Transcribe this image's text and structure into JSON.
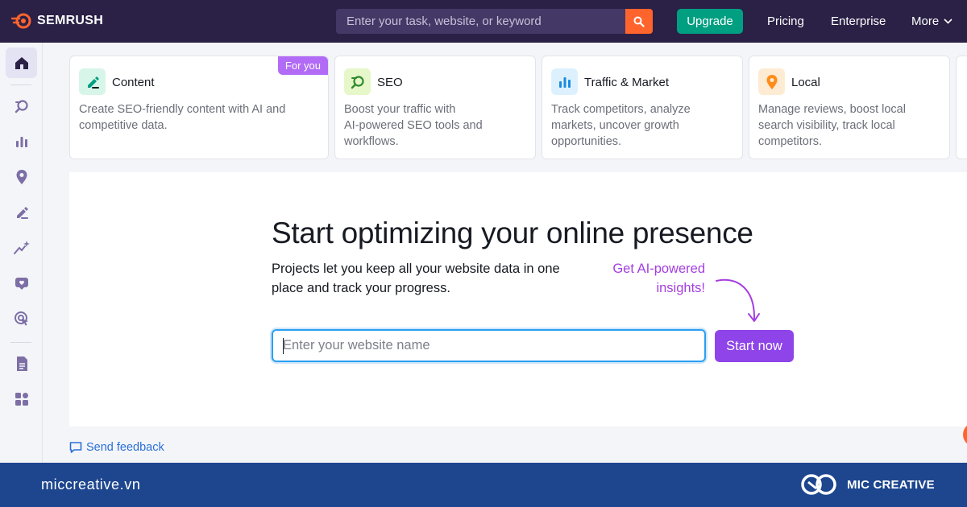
{
  "header": {
    "brand": "SEMRUSH",
    "search_placeholder": "Enter your task, website, or keyword",
    "upgrade_label": "Upgrade",
    "nav": {
      "pricing": "Pricing",
      "enterprise": "Enterprise",
      "more": "More"
    }
  },
  "sidebar": {
    "items": [
      {
        "icon": "home-icon",
        "active": true
      },
      {
        "icon": "seo-icon"
      },
      {
        "icon": "traffic-chart-icon"
      },
      {
        "icon": "location-pin-icon"
      },
      {
        "icon": "content-pen-icon"
      },
      {
        "icon": "ai-sparkle-icon"
      },
      {
        "icon": "social-heart-icon"
      },
      {
        "icon": "ads-target-icon"
      },
      {
        "icon": "reports-icon"
      },
      {
        "icon": "apps-grid-icon"
      }
    ]
  },
  "cards": [
    {
      "title": "Content",
      "badge": "For you",
      "desc_line1": "Create SEO-friendly content with AI and",
      "desc_line2": "competitive data.",
      "desc_line3": "",
      "icon": "content-pen-icon",
      "icon_bg": "#d8f5e9",
      "icon_color": "#009f81"
    },
    {
      "title": "SEO",
      "desc_line1": "Boost your traffic with",
      "desc_line2": "AI-powered SEO tools and",
      "desc_line3": "workflows.",
      "icon": "seo-icon",
      "icon_bg": "#e6f7c9",
      "icon_color": "#2e8b2e"
    },
    {
      "title": "Traffic & Market",
      "desc_line1": "Track competitors, analyze",
      "desc_line2": "markets, uncover growth",
      "desc_line3": "opportunities.",
      "icon": "traffic-chart-icon",
      "icon_bg": "#dcf1fd",
      "icon_color": "#1a8ce0"
    },
    {
      "title": "Local",
      "desc_line1": "Manage reviews, boost local",
      "desc_line2": "search visibility, track local",
      "desc_line3": "competitors.",
      "icon": "location-pin-icon",
      "icon_bg": "#fdebd3",
      "icon_color": "#ff8c1a"
    }
  ],
  "main": {
    "headline": "Start optimizing your online presence",
    "subtitle": "Projects let you keep all your website data in one place and track your progress.",
    "promo_line1": "Get AI-powered",
    "promo_line2": "insights!",
    "input_placeholder": "Enter your website name",
    "start_label": "Start now"
  },
  "feedback_label": "Send feedback",
  "footer": {
    "site": "miccreative.vn",
    "brand": "MIC CREATIVE"
  },
  "colors": {
    "topbar": "#2b2046",
    "accent_purple": "#8e44e8",
    "upgrade_green": "#009f81",
    "search_orange": "#ff642d",
    "footer_blue": "#1d468e"
  }
}
